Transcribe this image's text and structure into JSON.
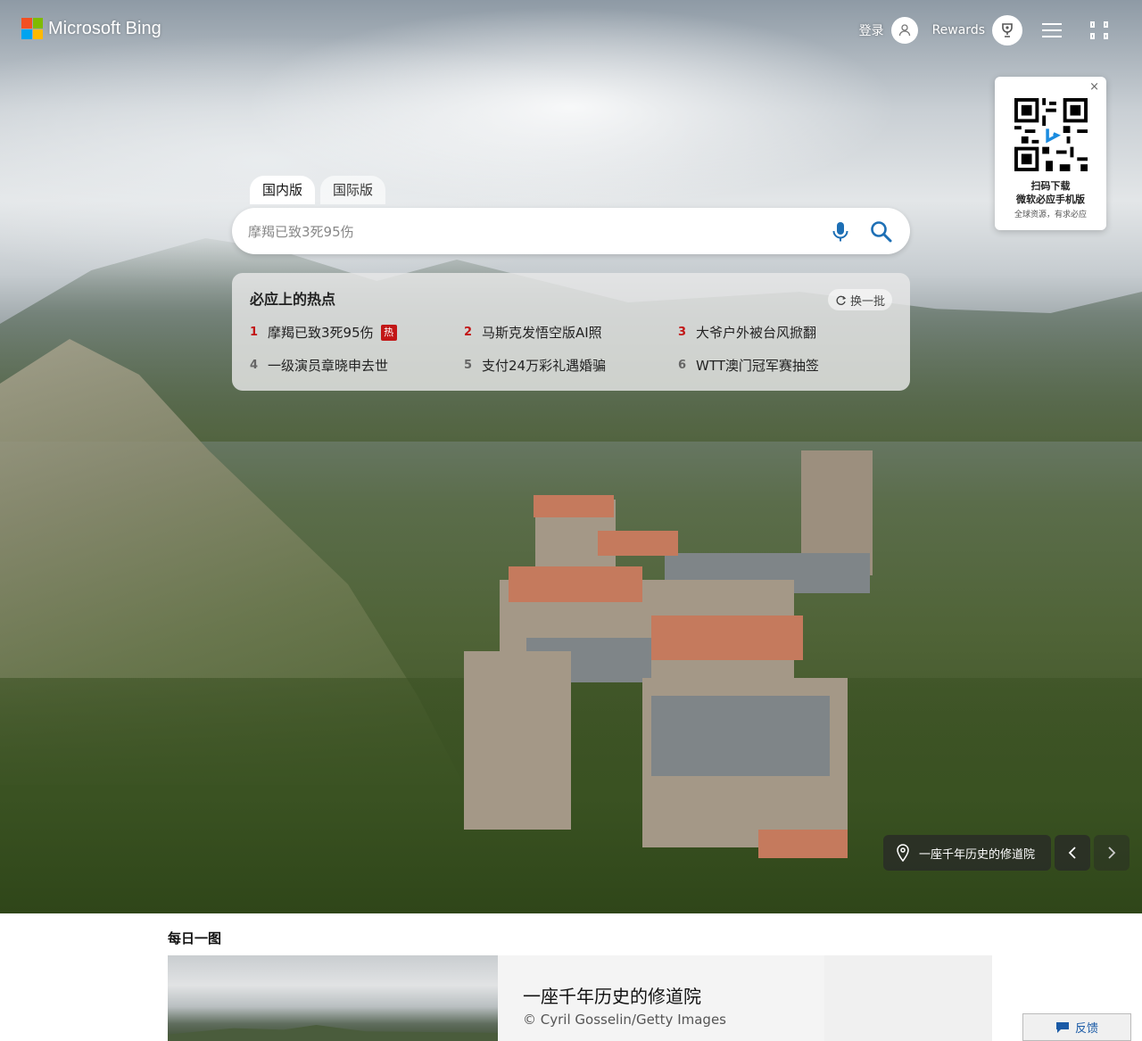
{
  "header": {
    "logo_text": "Microsoft Bing",
    "logo_colors": [
      "#f25022",
      "#7fba00",
      "#00a4ef",
      "#ffb900"
    ],
    "signin_label": "登录",
    "rewards_label": "Rewards",
    "icons": {
      "avatar": "user-icon",
      "rewards": "trophy-icon",
      "menu": "hamburger-icon",
      "qr": "qr-code-icon"
    }
  },
  "qr_popup": {
    "close_glyph": "×",
    "line1": "扫码下载",
    "line2": "微软必应手机版",
    "line3": "全球资源，有求必应"
  },
  "search": {
    "tabs": [
      {
        "label": "国内版",
        "active": true
      },
      {
        "label": "国际版",
        "active": false
      }
    ],
    "placeholder": "摩羯已致3死95伤",
    "value": ""
  },
  "hot": {
    "title": "必应上的热点",
    "refresh_label": "换一批",
    "badge_label": "热",
    "items": [
      {
        "rank": "1",
        "text": "摩羯已致3死95伤"
      },
      {
        "rank": "2",
        "text": "马斯克发悟空版AI照"
      },
      {
        "rank": "3",
        "text": "大爷户外被台风掀翻"
      },
      {
        "rank": "4",
        "text": "一级演员章晓申去世"
      },
      {
        "rank": "5",
        "text": "支付24万彩礼遇婚骗"
      },
      {
        "rank": "6",
        "text": "WTT澳门冠军赛抽签"
      }
    ]
  },
  "image_caption": "一座千年历史的修道院",
  "daily": {
    "section_title": "每日一图",
    "image_title": "一座千年历史的修道院",
    "copyright": "© Cyril Gosselin/Getty Images"
  },
  "feedback_label": "反馈",
  "colors": {
    "accent_red": "#c21616",
    "bing_teal": "#174ae4"
  }
}
